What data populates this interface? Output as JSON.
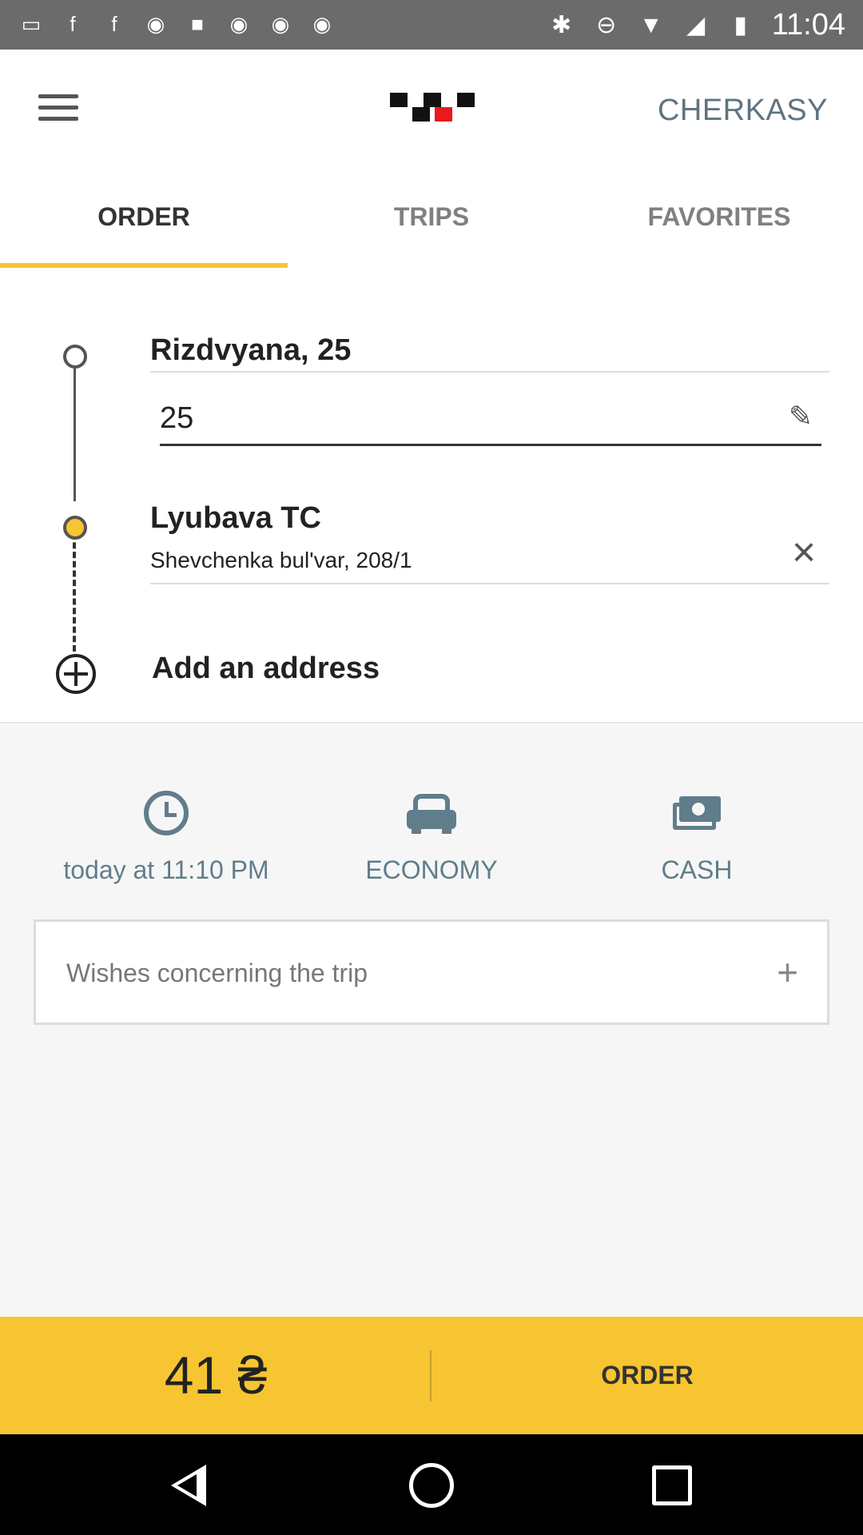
{
  "status_bar": {
    "time": "11:04",
    "left_icons": [
      "message-icon",
      "facebook-icon",
      "facebook-icon",
      "abc13-icon",
      "image-icon",
      "abc13-icon",
      "abc13-icon",
      "abc13-icon"
    ],
    "right_icons": [
      "bluetooth-icon",
      "do-not-disturb-icon",
      "wifi-icon",
      "signal-icon",
      "battery-icon"
    ]
  },
  "header": {
    "city": "CHERKASY"
  },
  "tabs": [
    {
      "label": "ORDER",
      "active": true
    },
    {
      "label": "TRIPS",
      "active": false
    },
    {
      "label": "FAVORITES",
      "active": false
    }
  ],
  "route": {
    "from": {
      "street": "Rizdvyana, 25",
      "house": "25"
    },
    "to": {
      "title": "Lyubava TC",
      "address": "Shevchenka bul'var, 208/1"
    },
    "add_label": "Add an address"
  },
  "options": {
    "time": {
      "label": "today at 11:10 PM",
      "icon": "clock-icon"
    },
    "tariff": {
      "label": "ECONOMY",
      "icon": "car-icon"
    },
    "payment": {
      "label": "CASH",
      "icon": "cash-icon"
    }
  },
  "wishes": {
    "placeholder": "Wishes concerning the trip",
    "plus": "+"
  },
  "bottom": {
    "price": "41 ₴",
    "order_label": "ORDER"
  },
  "colors": {
    "accent_yellow": "#f7c531",
    "muted_blue_grey": "#607d8b",
    "status_bar": "#6b6b6b"
  }
}
